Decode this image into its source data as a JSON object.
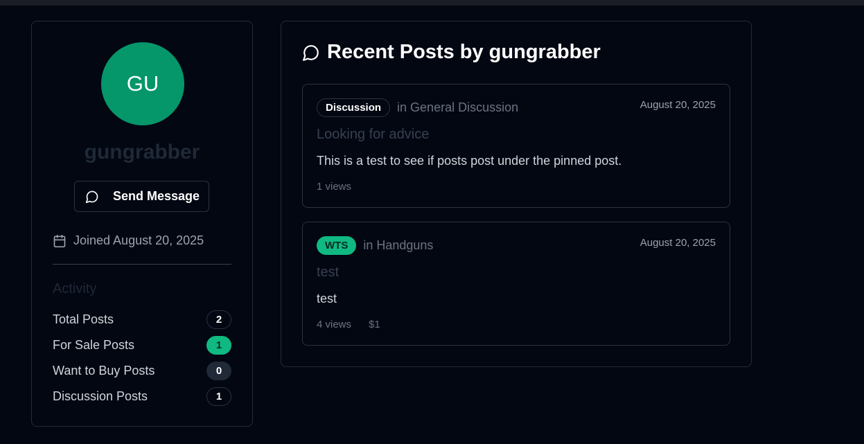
{
  "profile": {
    "avatar_initials": "GU",
    "username": "gungrabber",
    "send_message_label": "Send Message",
    "joined": "Joined August 20, 2025",
    "activity_title": "Activity",
    "stats": [
      {
        "label": "Total Posts",
        "count": "2"
      },
      {
        "label": "For Sale Posts",
        "count": "1"
      },
      {
        "label": "Want to Buy Posts",
        "count": "0"
      },
      {
        "label": "Discussion Posts",
        "count": "1"
      }
    ]
  },
  "posts_section": {
    "title": "Recent Posts by gungrabber",
    "posts": [
      {
        "tag": "Discussion",
        "category": "in General Discussion",
        "date": "August 20, 2025",
        "title": "Looking for advice",
        "body": "This is a test to see if posts post under the pinned post.",
        "views": "1 views",
        "price": ""
      },
      {
        "tag": "WTS",
        "category": "in Handguns",
        "date": "August 20, 2025",
        "title": "test",
        "body": "test",
        "views": "4 views",
        "price": "$1"
      }
    ]
  },
  "colors": {
    "background": "#030712",
    "accent_green": "#10b981",
    "avatar_green": "#059669"
  },
  "icons": {
    "message": "message-circle-icon",
    "calendar": "calendar-icon"
  }
}
